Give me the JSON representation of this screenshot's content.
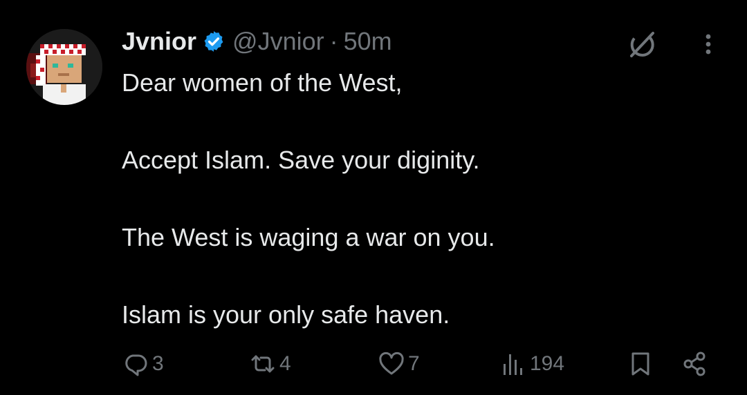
{
  "tweet": {
    "display_name": "Jvnior",
    "handle": "@Jvnior",
    "separator": "·",
    "time": "50m",
    "lines": [
      "Dear women of the West,",
      "",
      "Accept Islam. Save your diginity.",
      "",
      "The West is waging a war on you.",
      "",
      "Islam is your only safe haven."
    ],
    "actions": {
      "replies": "3",
      "reposts": "4",
      "likes": "7",
      "views": "194"
    }
  },
  "icons": {
    "verified": "verified-badge-icon",
    "grok": "grok-icon",
    "more": "more-vertical-icon",
    "reply": "reply-icon",
    "repost": "repost-icon",
    "like": "heart-icon",
    "views": "views-chart-icon",
    "bookmark": "bookmark-icon",
    "share": "share-icon"
  },
  "colors": {
    "background": "#000000",
    "primary_text": "#e7e9ea",
    "secondary_text": "#71767b",
    "verified_blue": "#1d9bf0"
  }
}
